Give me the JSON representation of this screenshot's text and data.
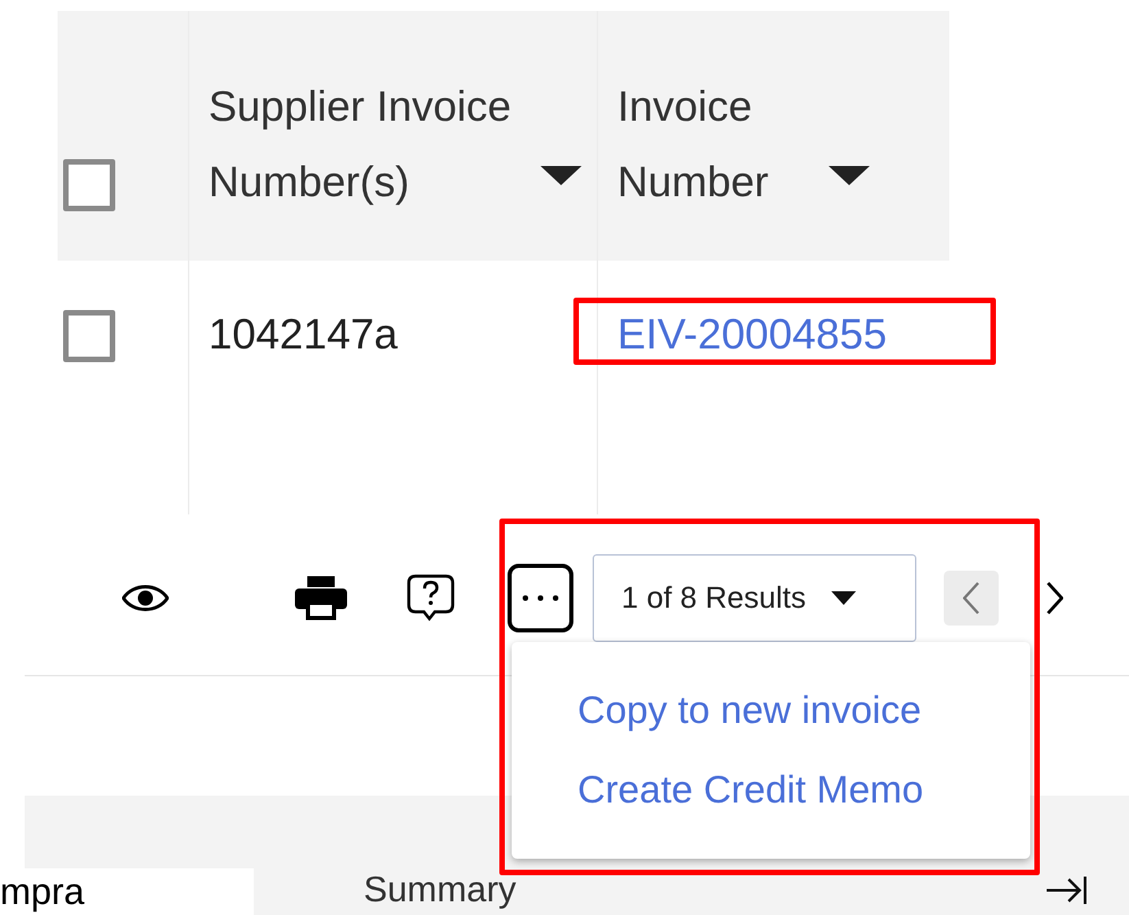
{
  "table": {
    "select_all": {
      "checked": false
    },
    "columns": [
      {
        "label": "Supplier Invoice Number(s)",
        "sort_descending": true
      },
      {
        "label": "Invoice Number",
        "sort_descending": true
      }
    ],
    "rows": [
      {
        "checked": false,
        "supplier_invoice_numbers": "1042147a",
        "invoice_number": "EIV-20004855",
        "highlighted": true
      }
    ]
  },
  "toolbar": {
    "buttons": [
      {
        "kind": "view",
        "pressed": false
      },
      {
        "kind": "print",
        "pressed": false
      },
      {
        "kind": "help",
        "pressed": false
      },
      {
        "kind": "more",
        "pressed": true
      }
    ],
    "results": "1 of 8 Results",
    "prev_disabled": true
  },
  "menu": {
    "open": true,
    "highlighted": true,
    "items": [
      "Copy to new invoice",
      "Create Credit Memo"
    ]
  },
  "footer": {
    "side_label": "mpra",
    "title": "Summary"
  }
}
